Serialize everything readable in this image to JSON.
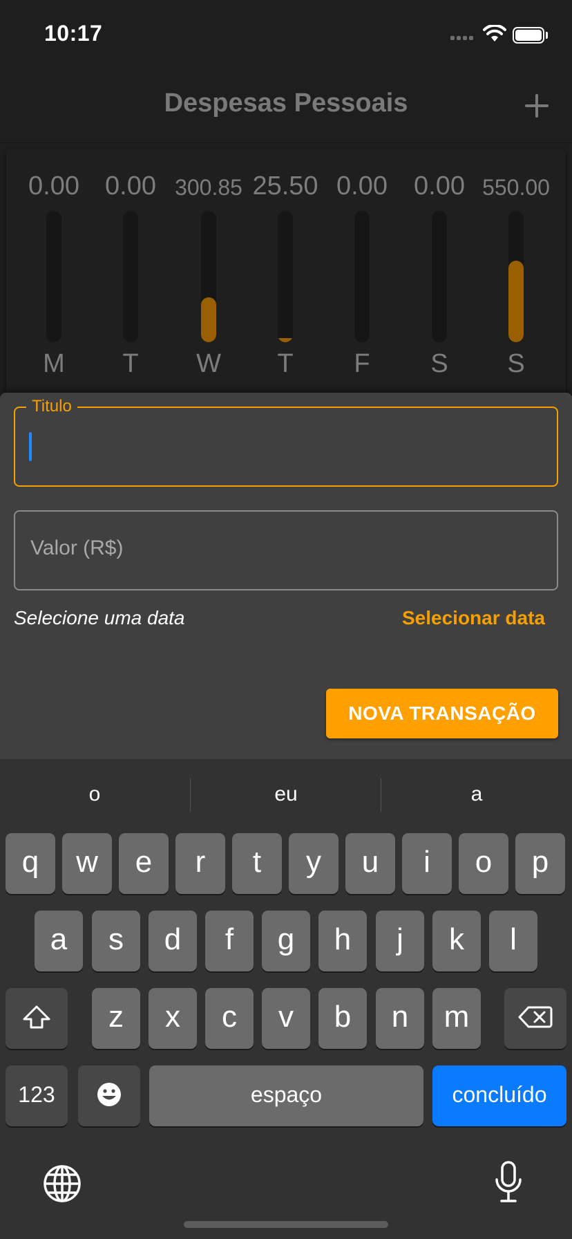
{
  "status": {
    "time": "10:17"
  },
  "app_bar": {
    "title": "Despesas Pessoais"
  },
  "chart_data": {
    "type": "bar",
    "categories": [
      "M",
      "T",
      "W",
      "T",
      "F",
      "S",
      "S"
    ],
    "value_labels": [
      "0.00",
      "0.00",
      "300.85",
      "25.50",
      "0.00",
      "0.00",
      "550.00"
    ],
    "values": [
      0.0,
      0.0,
      300.85,
      25.5,
      0.0,
      0.0,
      550.0
    ],
    "fill_fractions": [
      0,
      0,
      0.34,
      0.03,
      0,
      0,
      0.62
    ],
    "bar_color": "#9a5f00"
  },
  "form": {
    "title_label": "Titulo",
    "title_value": "",
    "value_placeholder": "Valor (R$)",
    "date_text": "Selecione uma data",
    "date_button": "Selecionar data",
    "submit_label": "NOVA TRANSAÇÃO",
    "accent_color": "#f5a000"
  },
  "keyboard": {
    "suggestions": [
      "o",
      "eu",
      "a"
    ],
    "row1": [
      "q",
      "w",
      "e",
      "r",
      "t",
      "y",
      "u",
      "i",
      "o",
      "p"
    ],
    "row2": [
      "a",
      "s",
      "d",
      "f",
      "g",
      "h",
      "j",
      "k",
      "l"
    ],
    "row3": [
      "z",
      "x",
      "c",
      "v",
      "b",
      "n",
      "m"
    ],
    "numbers_key": "123",
    "space_key": "espaço",
    "done_key": "concluído",
    "done_color": "#0a7aff"
  }
}
